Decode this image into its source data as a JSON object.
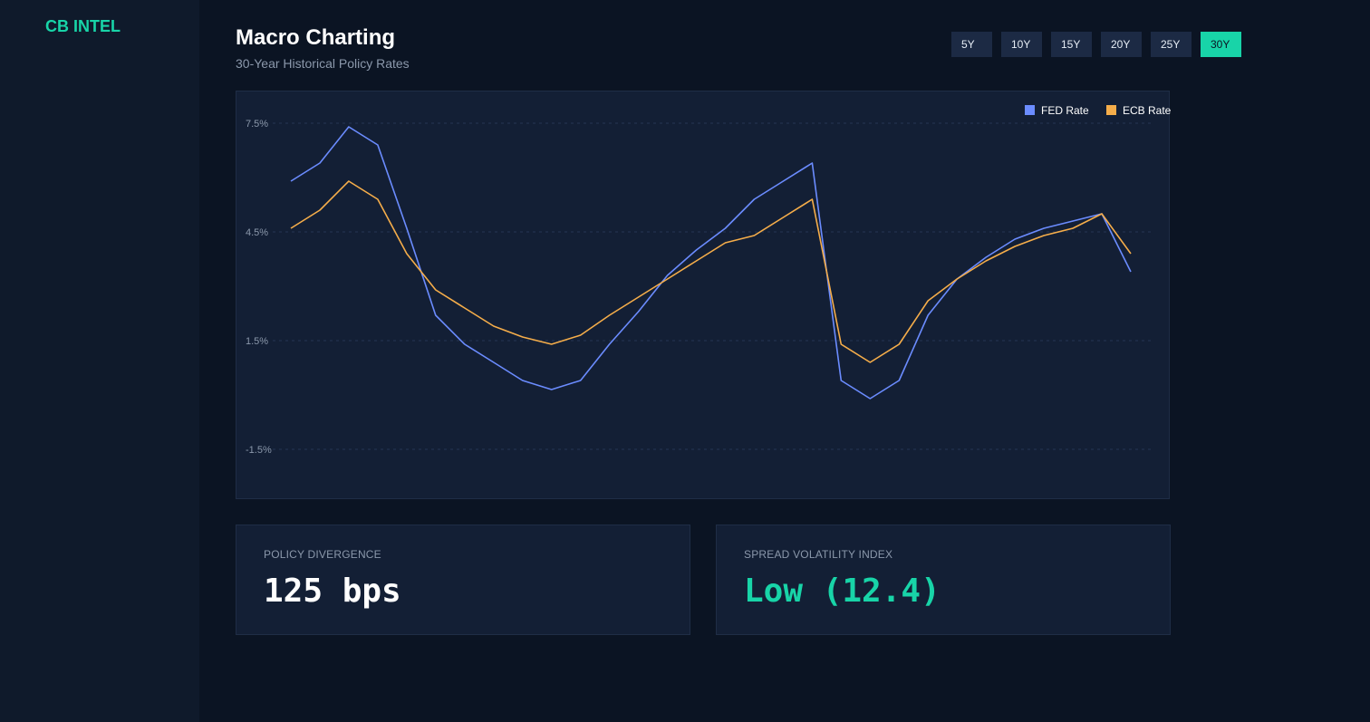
{
  "app": {
    "brand": "CB INTEL"
  },
  "header": {
    "title": "Macro Charting",
    "subtitle": "30-Year Historical Policy Rates"
  },
  "range_selector": {
    "options": [
      "5Y",
      "10Y",
      "15Y",
      "20Y",
      "25Y",
      "30Y"
    ],
    "selected": "30Y"
  },
  "chart_data": {
    "type": "line",
    "title": "",
    "xlabel": "",
    "ylabel": "",
    "y_ticks": [
      "7.5%",
      "4.5%",
      "1.5%",
      "-1.5%"
    ],
    "y_tick_values": [
      7.5,
      4.5,
      1.5,
      -1.5
    ],
    "ylim": [
      -2.8,
      8.4
    ],
    "grid": true,
    "legend_position": "top-right",
    "x": [
      0,
      1,
      2,
      3,
      4,
      5,
      6,
      7,
      8,
      9,
      10,
      11,
      12,
      13,
      14,
      15,
      16,
      17,
      18,
      19,
      20,
      21,
      22,
      23,
      24,
      25,
      26,
      27,
      28,
      29
    ],
    "series": [
      {
        "name": "FED Rate",
        "color": "#6b8cff",
        "values": [
          5.9,
          6.4,
          7.4,
          6.9,
          4.6,
          2.2,
          1.4,
          0.9,
          0.4,
          0.15,
          0.4,
          1.4,
          2.3,
          3.3,
          4.0,
          4.6,
          5.4,
          5.9,
          6.4,
          0.4,
          -0.1,
          0.4,
          2.2,
          3.2,
          3.8,
          4.3,
          4.6,
          4.8,
          5.0,
          3.4
        ]
      },
      {
        "name": "ECB Rate",
        "color": "#f5ad4a",
        "values": [
          4.6,
          5.1,
          5.9,
          5.4,
          3.9,
          2.9,
          2.4,
          1.9,
          1.6,
          1.4,
          1.65,
          2.2,
          2.7,
          3.2,
          3.7,
          4.2,
          4.4,
          4.9,
          5.4,
          1.4,
          0.9,
          1.4,
          2.6,
          3.2,
          3.7,
          4.1,
          4.4,
          4.6,
          5.0,
          3.9
        ]
      }
    ]
  },
  "stats": {
    "divergence": {
      "label": "POLICY DIVERGENCE",
      "value": "125 bps"
    },
    "volatility": {
      "label": "SPREAD VOLATILITY INDEX",
      "value": "Low (12.4)"
    }
  }
}
